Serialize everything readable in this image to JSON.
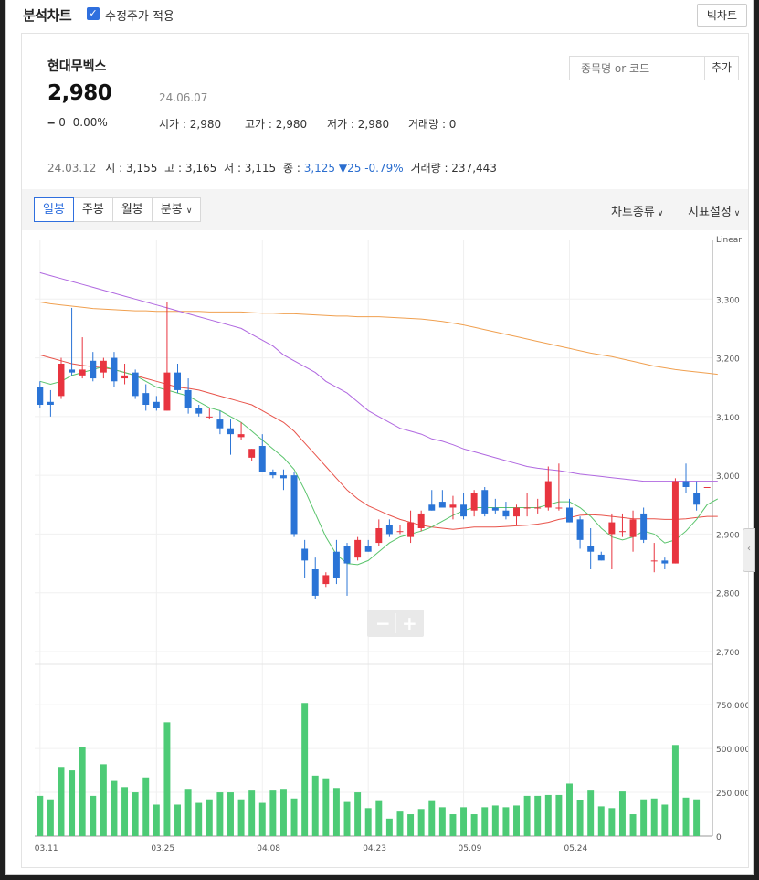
{
  "header": {
    "title": "분석차트",
    "adjusted_label": "수정주가 적용",
    "big_chart_label": "빅차트"
  },
  "stock": {
    "name": "현대무벡스",
    "price": "2,980",
    "date": "24.06.07",
    "change": "0",
    "change_pct": "0.00%",
    "open_label": "시가",
    "open": "2,980",
    "high_label": "고가",
    "high": "2,980",
    "low_label": "저가",
    "low": "2,980",
    "vol_label": "거래량",
    "vol": "0"
  },
  "search": {
    "placeholder": "종목명 or 코드",
    "add_label": "추가"
  },
  "hover_info": {
    "date": "24.03.12",
    "open_label": "시",
    "open": "3,155",
    "high_label": "고",
    "high": "3,165",
    "low_label": "저",
    "low": "3,115",
    "close_label": "종",
    "close": "3,125",
    "change": "▼25",
    "change_pct": "-0.79%",
    "vol_label": "거래량",
    "vol": "237,443"
  },
  "toolbar": {
    "tabs": [
      "일봉",
      "주봉",
      "월봉",
      "분봉"
    ],
    "active_tab": "일봉",
    "chart_type_label": "차트종류",
    "indicator_label": "지표설정"
  },
  "chart_data": {
    "type": "candlestick",
    "scale_label": "Linear",
    "price_ticks": [
      "3,300",
      "3,200",
      "3,100",
      "3,000",
      "2,900",
      "2,800",
      "2,700"
    ],
    "price_range": [
      2700,
      3400
    ],
    "volume_ticks": [
      "750,000",
      "500,000",
      "250,000",
      "0"
    ],
    "volume_range": [
      0,
      850000
    ],
    "x_labels": [
      {
        "i": 0,
        "label": "03.11"
      },
      {
        "i": 11,
        "label": "03.25"
      },
      {
        "i": 21,
        "label": "04.08"
      },
      {
        "i": 31,
        "label": "04.23"
      },
      {
        "i": 40,
        "label": "05.09"
      },
      {
        "i": 50,
        "label": "05.24"
      }
    ],
    "colors": {
      "up": "#e8343f",
      "down": "#2a74d6",
      "volume": "#4dcb76",
      "ma5": "#5ac46c",
      "ma20": "#e8534a",
      "ma60": "#b068e0",
      "ma120": "#f0a050"
    },
    "candles": [
      {
        "o": 3150,
        "h": 3160,
        "l": 3115,
        "c": 3120,
        "v": 230000
      },
      {
        "o": 3125,
        "h": 3145,
        "l": 3100,
        "c": 3120,
        "v": 210000
      },
      {
        "o": 3135,
        "h": 3200,
        "l": 3130,
        "c": 3190,
        "v": 395000
      },
      {
        "o": 3180,
        "h": 3285,
        "l": 3170,
        "c": 3175,
        "v": 375000
      },
      {
        "o": 3170,
        "h": 3235,
        "l": 3165,
        "c": 3180,
        "v": 510000
      },
      {
        "o": 3195,
        "h": 3210,
        "l": 3160,
        "c": 3165,
        "v": 230000
      },
      {
        "o": 3175,
        "h": 3200,
        "l": 3165,
        "c": 3195,
        "v": 410000
      },
      {
        "o": 3200,
        "h": 3210,
        "l": 3150,
        "c": 3160,
        "v": 315000
      },
      {
        "o": 3165,
        "h": 3190,
        "l": 3155,
        "c": 3170,
        "v": 280000
      },
      {
        "o": 3175,
        "h": 3180,
        "l": 3130,
        "c": 3135,
        "v": 250000
      },
      {
        "o": 3140,
        "h": 3155,
        "l": 3110,
        "c": 3120,
        "v": 335000
      },
      {
        "o": 3125,
        "h": 3135,
        "l": 3110,
        "c": 3115,
        "v": 180000
      },
      {
        "o": 3110,
        "h": 3295,
        "l": 3110,
        "c": 3175,
        "v": 650000
      },
      {
        "o": 3175,
        "h": 3190,
        "l": 3140,
        "c": 3145,
        "v": 180000
      },
      {
        "o": 3145,
        "h": 3165,
        "l": 3105,
        "c": 3115,
        "v": 270000
      },
      {
        "o": 3115,
        "h": 3120,
        "l": 3100,
        "c": 3105,
        "v": 190000
      },
      {
        "o": 3100,
        "h": 3115,
        "l": 3095,
        "c": 3100,
        "v": 210000
      },
      {
        "o": 3095,
        "h": 3110,
        "l": 3070,
        "c": 3080,
        "v": 250000
      },
      {
        "o": 3080,
        "h": 3095,
        "l": 3035,
        "c": 3070,
        "v": 250000
      },
      {
        "o": 3065,
        "h": 3090,
        "l": 3060,
        "c": 3070,
        "v": 210000
      },
      {
        "o": 3030,
        "h": 3045,
        "l": 3025,
        "c": 3045,
        "v": 260000
      },
      {
        "o": 3050,
        "h": 3070,
        "l": 3020,
        "c": 3005,
        "v": 190000
      },
      {
        "o": 3005,
        "h": 3010,
        "l": 2995,
        "c": 3000,
        "v": 260000
      },
      {
        "o": 3000,
        "h": 3010,
        "l": 2975,
        "c": 2995,
        "v": 270000
      },
      {
        "o": 3000,
        "h": 3005,
        "l": 2895,
        "c": 2900,
        "v": 215000
      },
      {
        "o": 2875,
        "h": 2890,
        "l": 2825,
        "c": 2855,
        "v": 760000
      },
      {
        "o": 2840,
        "h": 2860,
        "l": 2790,
        "c": 2795,
        "v": 345000
      },
      {
        "o": 2815,
        "h": 2835,
        "l": 2810,
        "c": 2830,
        "v": 330000
      },
      {
        "o": 2870,
        "h": 2890,
        "l": 2815,
        "c": 2825,
        "v": 275000
      },
      {
        "o": 2880,
        "h": 2885,
        "l": 2795,
        "c": 2850,
        "v": 195000
      },
      {
        "o": 2860,
        "h": 2895,
        "l": 2855,
        "c": 2890,
        "v": 250000
      },
      {
        "o": 2880,
        "h": 2890,
        "l": 2870,
        "c": 2870,
        "v": 160000
      },
      {
        "o": 2885,
        "h": 2925,
        "l": 2880,
        "c": 2910,
        "v": 200000
      },
      {
        "o": 2915,
        "h": 2925,
        "l": 2895,
        "c": 2900,
        "v": 100000
      },
      {
        "o": 2905,
        "h": 2915,
        "l": 2900,
        "c": 2905,
        "v": 140000
      },
      {
        "o": 2895,
        "h": 2940,
        "l": 2885,
        "c": 2920,
        "v": 125000
      },
      {
        "o": 2910,
        "h": 2940,
        "l": 2905,
        "c": 2935,
        "v": 155000
      },
      {
        "o": 2950,
        "h": 2975,
        "l": 2940,
        "c": 2940,
        "v": 200000
      },
      {
        "o": 2955,
        "h": 2975,
        "l": 2950,
        "c": 2945,
        "v": 165000
      },
      {
        "o": 2945,
        "h": 2965,
        "l": 2925,
        "c": 2950,
        "v": 125000
      },
      {
        "o": 2950,
        "h": 2970,
        "l": 2925,
        "c": 2930,
        "v": 165000
      },
      {
        "o": 2940,
        "h": 2975,
        "l": 2930,
        "c": 2970,
        "v": 125000
      },
      {
        "o": 2975,
        "h": 2980,
        "l": 2930,
        "c": 2935,
        "v": 165000
      },
      {
        "o": 2945,
        "h": 2960,
        "l": 2935,
        "c": 2940,
        "v": 175000
      },
      {
        "o": 2940,
        "h": 2955,
        "l": 2925,
        "c": 2930,
        "v": 165000
      },
      {
        "o": 2930,
        "h": 2950,
        "l": 2915,
        "c": 2945,
        "v": 175000
      },
      {
        "o": 2945,
        "h": 2970,
        "l": 2930,
        "c": 2945,
        "v": 230000
      },
      {
        "o": 2945,
        "h": 2960,
        "l": 2935,
        "c": 2945,
        "v": 230000
      },
      {
        "o": 2945,
        "h": 3015,
        "l": 2940,
        "c": 2990,
        "v": 235000
      },
      {
        "o": 2945,
        "h": 3020,
        "l": 2940,
        "c": 2945,
        "v": 235000
      },
      {
        "o": 2945,
        "h": 2960,
        "l": 2920,
        "c": 2920,
        "v": 300000
      },
      {
        "o": 2925,
        "h": 2930,
        "l": 2875,
        "c": 2890,
        "v": 205000
      },
      {
        "o": 2880,
        "h": 2910,
        "l": 2840,
        "c": 2870,
        "v": 260000
      },
      {
        "o": 2865,
        "h": 2870,
        "l": 2855,
        "c": 2855,
        "v": 170000
      },
      {
        "o": 2900,
        "h": 2935,
        "l": 2840,
        "c": 2920,
        "v": 160000
      },
      {
        "o": 2905,
        "h": 2935,
        "l": 2895,
        "c": 2905,
        "v": 255000
      },
      {
        "o": 2895,
        "h": 2940,
        "l": 2870,
        "c": 2925,
        "v": 125000
      },
      {
        "o": 2935,
        "h": 2945,
        "l": 2885,
        "c": 2890,
        "v": 210000
      },
      {
        "o": 2855,
        "h": 2885,
        "l": 2835,
        "c": 2855,
        "v": 215000
      },
      {
        "o": 2855,
        "h": 2860,
        "l": 2840,
        "c": 2850,
        "v": 180000
      },
      {
        "o": 2850,
        "h": 2995,
        "l": 2850,
        "c": 2990,
        "v": 520000
      },
      {
        "o": 2990,
        "h": 3020,
        "l": 2970,
        "c": 2980,
        "v": 220000
      },
      {
        "o": 2970,
        "h": 2990,
        "l": 2940,
        "c": 2950,
        "v": 210000
      },
      {
        "o": 2980,
        "h": 2980,
        "l": 2980,
        "c": 2980,
        "v": 0
      }
    ],
    "ma": {
      "ma5": [
        3160,
        3155,
        3160,
        3170,
        3175,
        3180,
        3185,
        3180,
        3175,
        3170,
        3160,
        3150,
        3145,
        3140,
        3135,
        3125,
        3115,
        3110,
        3100,
        3090,
        3075,
        3060,
        3045,
        3030,
        3010,
        2975,
        2935,
        2895,
        2865,
        2850,
        2848,
        2855,
        2870,
        2885,
        2895,
        2900,
        2905,
        2912,
        2922,
        2932,
        2940,
        2945,
        2945,
        2945,
        2945,
        2945,
        2945,
        2945,
        2950,
        2955,
        2955,
        2945,
        2930,
        2910,
        2895,
        2890,
        2895,
        2905,
        2900,
        2885,
        2890,
        2905,
        2925,
        2950,
        2960
      ],
      "ma20": [
        3205,
        3200,
        3195,
        3190,
        3187,
        3185,
        3183,
        3180,
        3175,
        3170,
        3165,
        3160,
        3155,
        3150,
        3148,
        3145,
        3140,
        3135,
        3130,
        3125,
        3120,
        3110,
        3100,
        3090,
        3075,
        3055,
        3035,
        3015,
        2995,
        2975,
        2960,
        2948,
        2940,
        2932,
        2925,
        2920,
        2915,
        2912,
        2910,
        2908,
        2910,
        2912,
        2912,
        2912,
        2913,
        2914,
        2915,
        2917,
        2920,
        2925,
        2928,
        2932,
        2933,
        2932,
        2930,
        2928,
        2926,
        2926,
        2926,
        2925,
        2925,
        2926,
        2928,
        2930,
        2930
      ],
      "ma60": [
        3345,
        3340,
        3335,
        3330,
        3325,
        3320,
        3315,
        3310,
        3305,
        3300,
        3295,
        3290,
        3285,
        3280,
        3275,
        3270,
        3265,
        3260,
        3255,
        3250,
        3240,
        3230,
        3220,
        3205,
        3195,
        3185,
        3175,
        3160,
        3150,
        3140,
        3125,
        3110,
        3100,
        3090,
        3080,
        3075,
        3070,
        3062,
        3058,
        3052,
        3045,
        3040,
        3035,
        3030,
        3025,
        3020,
        3015,
        3012,
        3010,
        3008,
        3005,
        3002,
        3000,
        2998,
        2996,
        2994,
        2992,
        2990,
        2990,
        2990,
        2990,
        2990,
        2990,
        2990,
        2990
      ],
      "ma120": [
        3295,
        3292,
        3290,
        3288,
        3286,
        3284,
        3283,
        3282,
        3281,
        3280,
        3280,
        3279,
        3279,
        3279,
        3279,
        3279,
        3278,
        3278,
        3278,
        3278,
        3277,
        3276,
        3276,
        3275,
        3275,
        3274,
        3273,
        3272,
        3271,
        3271,
        3270,
        3270,
        3270,
        3269,
        3268,
        3267,
        3266,
        3264,
        3262,
        3259,
        3256,
        3252,
        3248,
        3244,
        3240,
        3236,
        3232,
        3228,
        3224,
        3220,
        3216,
        3212,
        3208,
        3205,
        3202,
        3198,
        3194,
        3190,
        3186,
        3183,
        3180,
        3178,
        3176,
        3174,
        3172
      ]
    }
  }
}
